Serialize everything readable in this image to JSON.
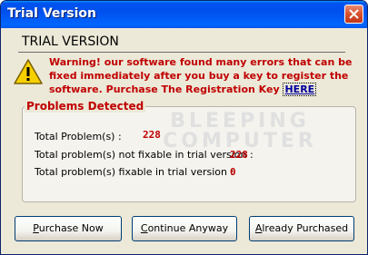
{
  "window": {
    "title": "Trial Version"
  },
  "header": {
    "title": "TRIAL VERSION"
  },
  "warning": {
    "text": "Warning! our software found many errors that can be fixed immediately after you buy a key to register the software. Purchase The Registration Key",
    "link_label": "HERE"
  },
  "problems": {
    "legend": "Problems Detected",
    "watermark_line1": "BLEEPING",
    "watermark_line2": "COMPUTER",
    "rows": [
      {
        "label": "Total Problem(s) :",
        "value": "228"
      },
      {
        "label": "Total problem(s) not fixable in trial version :",
        "value": "228"
      },
      {
        "label": "Total problem(s) fixable in trial version :",
        "value": "0"
      }
    ]
  },
  "buttons": {
    "purchase_first": "P",
    "purchase_rest": "urchase Now",
    "continue_first": "C",
    "continue_rest": "ontinue Anyway",
    "already_first": "A",
    "already_rest": "lready Purchased"
  },
  "colors": {
    "title_bar": "#0055ea",
    "warning_text": "#c00000",
    "link": "#00009c"
  },
  "icons": {
    "warning": "warning-triangle-icon",
    "close": "close-icon"
  }
}
